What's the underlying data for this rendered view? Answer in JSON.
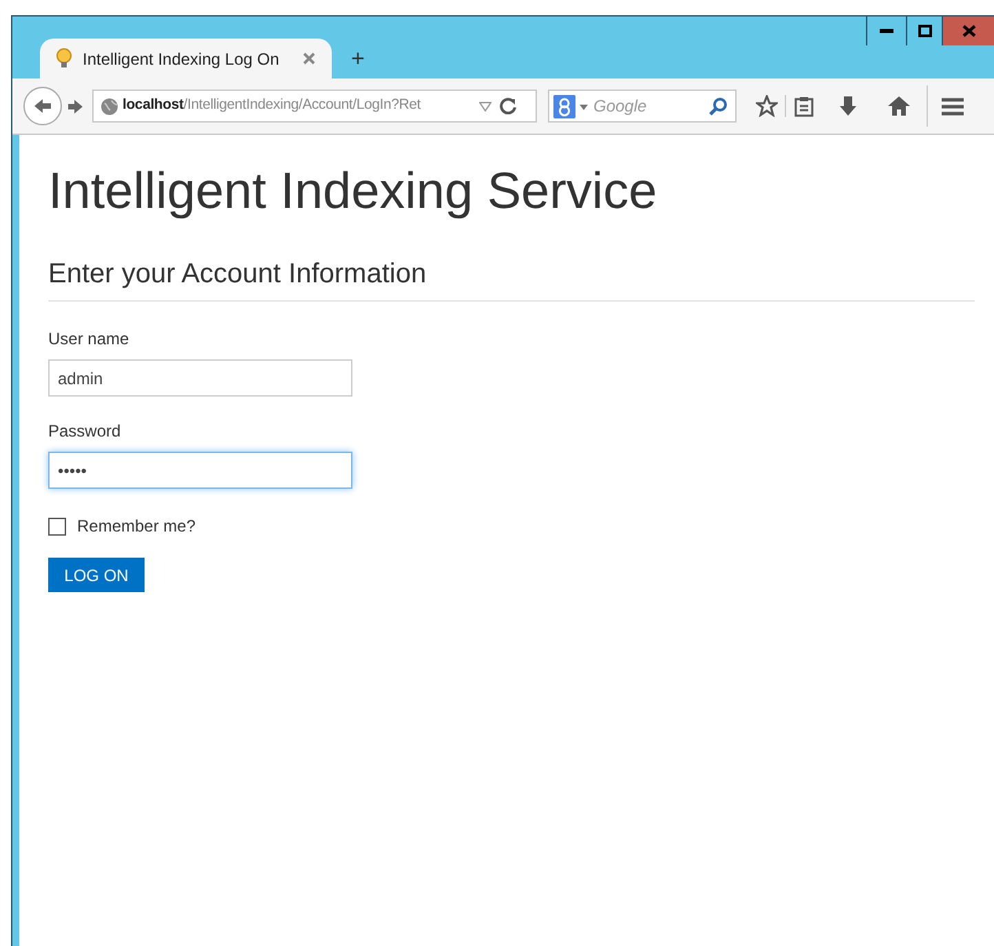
{
  "window": {
    "controls": [
      {
        "kind": "minimize"
      },
      {
        "kind": "maximize"
      },
      {
        "kind": "close"
      }
    ]
  },
  "tabs": [
    {
      "title": "Intelligent Indexing Log On",
      "selected": true
    }
  ],
  "new_tab": "+",
  "address_bar": {
    "host": "localhost",
    "path": "/IntelligentIndexing/Account/LogIn?Ret"
  },
  "search": {
    "placeholder": "Google"
  },
  "page": {
    "title": "Intelligent Indexing Service",
    "heading": "Enter your Account Information",
    "fields": [
      {
        "label": "User name",
        "value": "admin",
        "focused": false
      },
      {
        "label": "Password",
        "value": "•••••",
        "focused": true
      }
    ],
    "remember": {
      "label": "Remember me?",
      "checked": false
    },
    "button": "LOG ON"
  }
}
